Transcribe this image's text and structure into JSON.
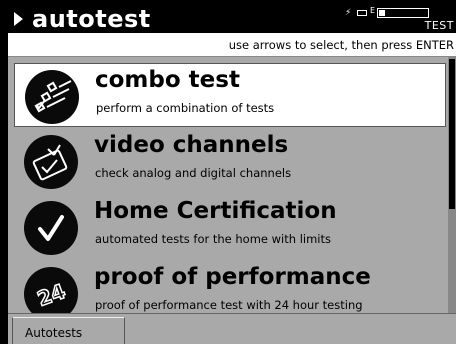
{
  "header": {
    "title": "autotest",
    "status_label": "TEST",
    "status_icons": [
      "bolt-icon",
      "battery-icon"
    ]
  },
  "instruction": "use arrows to select, then press ENTER",
  "items": [
    {
      "title": "combo test",
      "subtitle": "perform a combination of tests",
      "icon": "checklist-icon",
      "selected": true
    },
    {
      "title": "video channels",
      "subtitle": "check analog and digital channels",
      "icon": "tv-check-icon",
      "selected": false
    },
    {
      "title": "Home Certification",
      "subtitle": "automated tests for the home with limits",
      "icon": "checkmark-icon",
      "selected": false
    },
    {
      "title": "proof of performance",
      "subtitle": "proof of performance test with 24 hour testing",
      "icon": "24-hour-icon",
      "selected": false
    }
  ],
  "tabs": [
    {
      "label": "Autotests"
    }
  ]
}
